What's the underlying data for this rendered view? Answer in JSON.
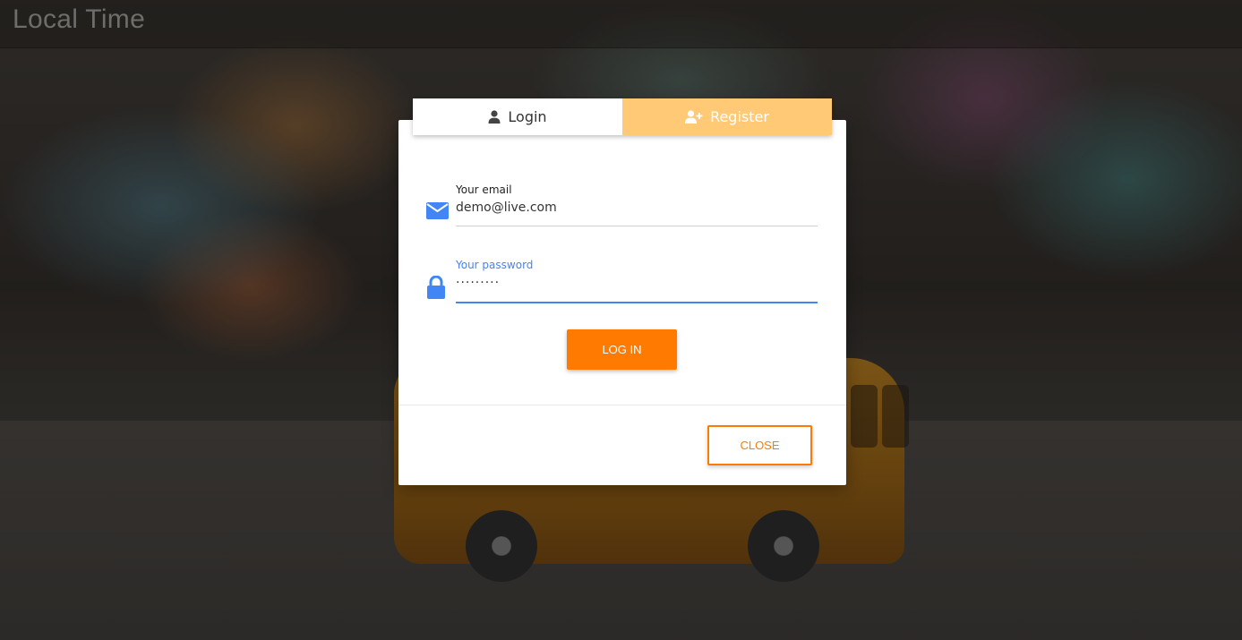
{
  "app": {
    "title": "Local Time"
  },
  "tabs": [
    {
      "label": "Login",
      "icon": "user-icon"
    },
    {
      "label": "Register",
      "icon": "user-plus-icon"
    }
  ],
  "form": {
    "email": {
      "label": "Your email",
      "value": "demo@live.com",
      "icon": "envelope-icon"
    },
    "password": {
      "label": "Your password",
      "value": "·········",
      "icon": "lock-icon"
    },
    "submit_label": "LOG IN"
  },
  "footer": {
    "close_label": "CLOSE"
  },
  "colors": {
    "accent": "#ff7a00",
    "focus": "#4285f4",
    "register_tab": "#ffc976"
  }
}
